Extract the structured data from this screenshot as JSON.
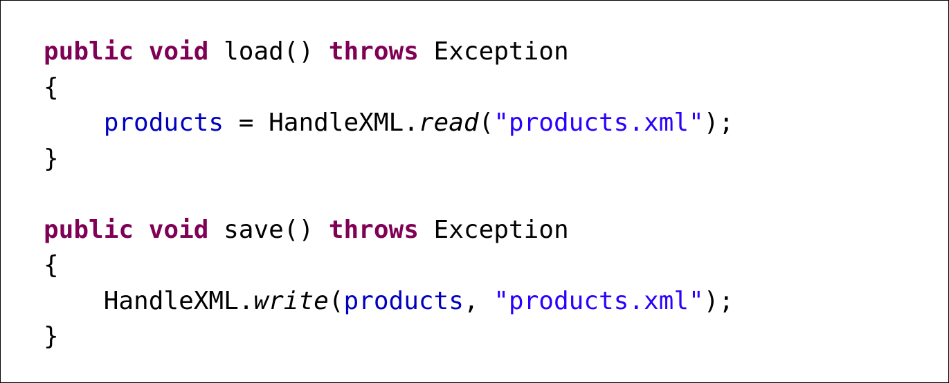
{
  "code": {
    "lines": [
      [
        {
          "t": "public",
          "k": "kw"
        },
        {
          "t": " ",
          "k": "plain"
        },
        {
          "t": "void",
          "k": "kw"
        },
        {
          "t": " load() ",
          "k": "plain"
        },
        {
          "t": "throws",
          "k": "kw"
        },
        {
          "t": " Exception",
          "k": "plain"
        }
      ],
      [
        {
          "t": "{",
          "k": "plain"
        }
      ],
      [
        {
          "t": "    ",
          "k": "plain"
        },
        {
          "t": "products",
          "k": "field"
        },
        {
          "t": " = HandleXML.",
          "k": "plain"
        },
        {
          "t": "read",
          "k": "static-call"
        },
        {
          "t": "(",
          "k": "plain"
        },
        {
          "t": "\"products.xml\"",
          "k": "str"
        },
        {
          "t": ");",
          "k": "plain"
        }
      ],
      [
        {
          "t": "}",
          "k": "plain"
        }
      ],
      [],
      [
        {
          "t": "public",
          "k": "kw"
        },
        {
          "t": " ",
          "k": "plain"
        },
        {
          "t": "void",
          "k": "kw"
        },
        {
          "t": " save() ",
          "k": "plain"
        },
        {
          "t": "throws",
          "k": "kw"
        },
        {
          "t": " Exception",
          "k": "plain"
        }
      ],
      [
        {
          "t": "{",
          "k": "plain"
        }
      ],
      [
        {
          "t": "    HandleXML.",
          "k": "plain"
        },
        {
          "t": "write",
          "k": "static-call"
        },
        {
          "t": "(",
          "k": "plain"
        },
        {
          "t": "products",
          "k": "field"
        },
        {
          "t": ", ",
          "k": "plain"
        },
        {
          "t": "\"products.xml\"",
          "k": "str"
        },
        {
          "t": ");",
          "k": "plain"
        }
      ],
      [
        {
          "t": "}",
          "k": "plain"
        }
      ]
    ]
  },
  "colors": {
    "keyword": "#7f0055",
    "field": "#0000c0",
    "string": "#2a00ff",
    "text": "#000000",
    "border": "#000000"
  }
}
